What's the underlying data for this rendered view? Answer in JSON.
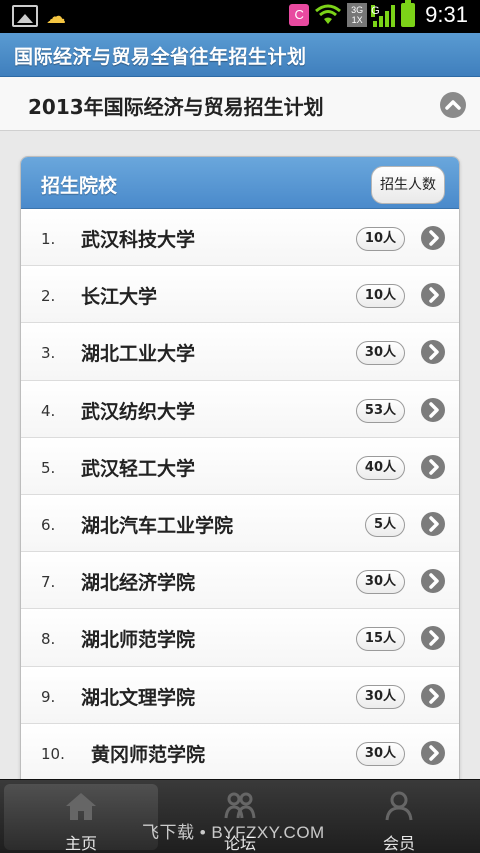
{
  "status_bar": {
    "app_badge": "C",
    "network_3g": "3G",
    "network_1x": "1X",
    "network_g": "G",
    "time": "9:31"
  },
  "header": {
    "title": "国际经济与贸易全省往年招生计划"
  },
  "section": {
    "title": "2013年国际经济与贸易招生计划"
  },
  "list": {
    "header_label": "招生院校",
    "column_button": "招生人数",
    "items": [
      {
        "index": "1.",
        "name": "武汉科技大学",
        "count": "10人"
      },
      {
        "index": "2.",
        "name": "长江大学",
        "count": "10人"
      },
      {
        "index": "3.",
        "name": "湖北工业大学",
        "count": "30人"
      },
      {
        "index": "4.",
        "name": "武汉纺织大学",
        "count": "53人"
      },
      {
        "index": "5.",
        "name": "武汉轻工大学",
        "count": "40人"
      },
      {
        "index": "6.",
        "name": "湖北汽车工业学院",
        "count": "5人"
      },
      {
        "index": "7.",
        "name": "湖北经济学院",
        "count": "30人"
      },
      {
        "index": "8.",
        "name": "湖北师范学院",
        "count": "15人"
      },
      {
        "index": "9.",
        "name": "湖北文理学院",
        "count": "30人"
      },
      {
        "index": "10.",
        "name": "黄冈师范学院",
        "count": "30人"
      }
    ]
  },
  "bottom_nav": {
    "items": [
      {
        "label": "主页",
        "icon": "home-icon"
      },
      {
        "label": "论坛",
        "icon": "forum-icon"
      },
      {
        "label": "会员",
        "icon": "member-icon"
      }
    ]
  },
  "watermark": "飞下载 • BYFZXY.COM"
}
